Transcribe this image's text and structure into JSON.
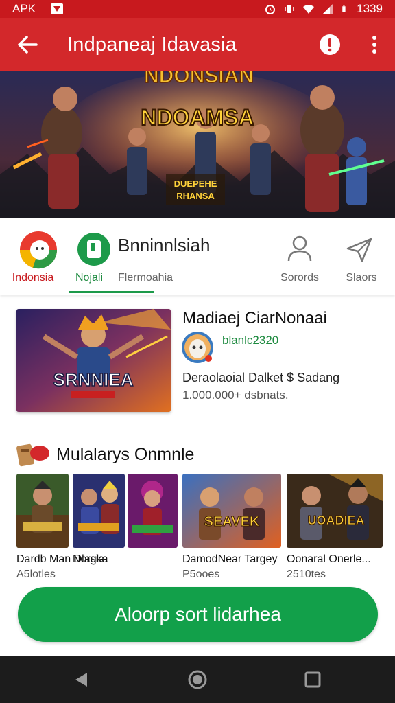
{
  "status_bar": {
    "carrier": "APK",
    "time": "1339"
  },
  "app_bar": {
    "title": "Indpaneaj Idavasia"
  },
  "tabs": {
    "items": [
      {
        "label": "Indonsia"
      },
      {
        "label": "Nojali"
      }
    ],
    "heading": "Bnninnlsiah",
    "subheading": "Flermoahia",
    "search_label": "Sorords",
    "share_label": "Slaors"
  },
  "featured": {
    "image_text": "SRNNIEA",
    "title": "Madiaej CiarNonaai",
    "version": "blanlc2320",
    "description": "Deraolaoial Dalket $ Sadang",
    "downloads": "1.000.000+ dsbnats."
  },
  "section": {
    "title": "Mulalarys Onmnle"
  },
  "games": [
    {
      "name": "Dardb Man Dlasia",
      "size": "A5lotles"
    },
    {
      "name": "Norgka",
      "size": ""
    },
    {
      "name": "DamodNear Targey",
      "size": "P5ooes",
      "thumb_text": "SEAVEK"
    },
    {
      "name": "Oonaral Onerle...",
      "size": "2510tes",
      "thumb_text": "UOADIEA"
    }
  ],
  "cta": {
    "label": "Aloorp sort lidarhea"
  },
  "banner": {
    "logo_text": "NDOAMSA",
    "sub_text": "DUEPEHE RHANSA"
  },
  "colors": {
    "app_bar": "#d3282b",
    "status_bar": "#c8191e",
    "accent_green": "#12a04a",
    "nav_bar": "#1c1c1c"
  }
}
